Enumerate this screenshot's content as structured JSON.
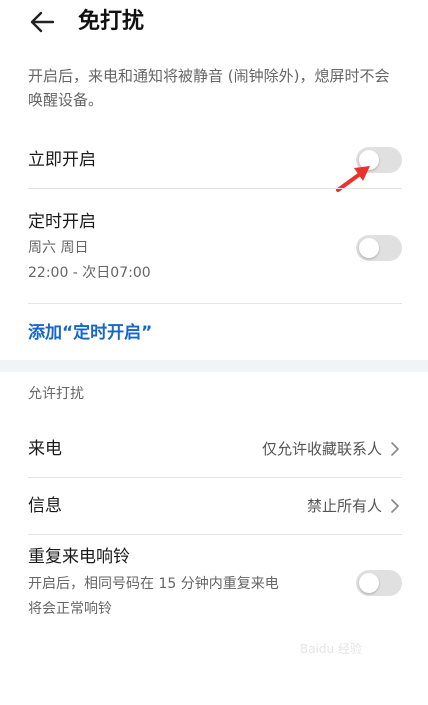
{
  "header": {
    "title": "免打扰"
  },
  "description": "开启后，来电和通知将被静音 (闹钟除外)，熄屏时不会唤醒设备。",
  "immediate": {
    "label": "立即开启",
    "enabled": false
  },
  "scheduled": {
    "label": "定时开启",
    "days": "周六 周日",
    "time": "22:00 - 次日07:00",
    "enabled": false
  },
  "add_schedule": {
    "label": "添加“定时开启”"
  },
  "allow_section": {
    "header": "允许打扰",
    "calls": {
      "label": "来电",
      "value": "仅允许收藏联系人"
    },
    "messages": {
      "label": "信息",
      "value": "禁止所有人"
    },
    "repeat_calls": {
      "label": "重复来电响铃",
      "line1": "开启后，相同号码在 15 分钟内重复来电",
      "line2": "将会正常响铃",
      "enabled": false
    }
  },
  "watermark": "Baidu 经验",
  "colors": {
    "accent": "#1767c7",
    "annotation_arrow": "#e8322b"
  }
}
